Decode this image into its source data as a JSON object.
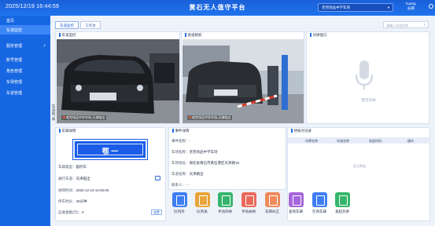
{
  "header": {
    "datetime": "2025/12/19 16:44:59",
    "title": "黄石无人值守平台",
    "lane_selector": "老完场品中学车场",
    "user": {
      "name": "huang",
      "role": "长期"
    }
  },
  "sidebar": {
    "items": [
      {
        "label": "首页",
        "active": false
      },
      {
        "label": "车道监控",
        "active": true
      },
      {
        "label": "服务管理",
        "active": false,
        "expandable": true
      },
      {
        "label": "账号管理",
        "active": false
      },
      {
        "label": "角色管理",
        "active": false
      },
      {
        "label": "车场管理",
        "active": false
      },
      {
        "label": "车道管理",
        "active": false
      }
    ]
  },
  "tabs": [
    {
      "label": "车道监控",
      "active": true
    },
    {
      "label": "工作台",
      "active": false
    }
  ],
  "search": {
    "placeholder": "请输入车道名称"
  },
  "lane_monitor": {
    "title": "车道监控",
    "camera_label": "老完场品中学车场-天津临出"
  },
  "entry_camera": {
    "title": "进道相机",
    "camera_label": "老完场品中学车场-天津临出"
  },
  "intercom": {
    "title": "对讲窗口",
    "status": "暂无对讲"
  },
  "lane_list_label": "车道列表",
  "vehicle_details": {
    "title": "车辆详情",
    "plate": "鄂    一",
    "vehicle_type_label": "车辆类型：",
    "vehicle_type": "临时车",
    "lane_label": "通行车道：",
    "lane": "天津临出",
    "entry_time_label": "进场时间：",
    "entry_time": "2025-12-19 16:06:05",
    "duration_label": "停车时长：",
    "duration": "39分钟",
    "fee_label": "应收金额(元)：",
    "fee": "0",
    "settle_button": "收费"
  },
  "event_details": {
    "title": "事件详情",
    "fields": [
      {
        "label": "事件名称：",
        "value": "-"
      },
      {
        "label": "车场名称：",
        "value": "老完场品中学车场"
      },
      {
        "label": "车场地址：",
        "value": "湖北省黄石市黄石港区天津路15"
      },
      {
        "label": "车道名称：",
        "value": "天津路出"
      },
      {
        "label": "联系人：",
        "value": "-   -"
      }
    ]
  },
  "pending_plates": {
    "title": "待核对记录",
    "columns": [
      "车牌名称",
      "车道名称",
      "发起时间",
      "操作"
    ],
    "empty_text": "暂无数据"
  },
  "actions": [
    {
      "label": "队列开",
      "color": "#3f7ef3"
    },
    {
      "label": "队列关",
      "color": "#e7a53a"
    },
    {
      "label": "手动开闸",
      "color": "#35b56b"
    },
    {
      "label": "手动关闸",
      "color": "#ea6a5a"
    },
    {
      "label": "车牌纠正",
      "color": "#f08a5c"
    },
    {
      "label": "查询车辆",
      "color": "#a566db"
    },
    {
      "label": "在场车辆",
      "color": "#3f7ef3"
    },
    {
      "label": "发起对讲",
      "color": "#35b56b"
    }
  ]
}
